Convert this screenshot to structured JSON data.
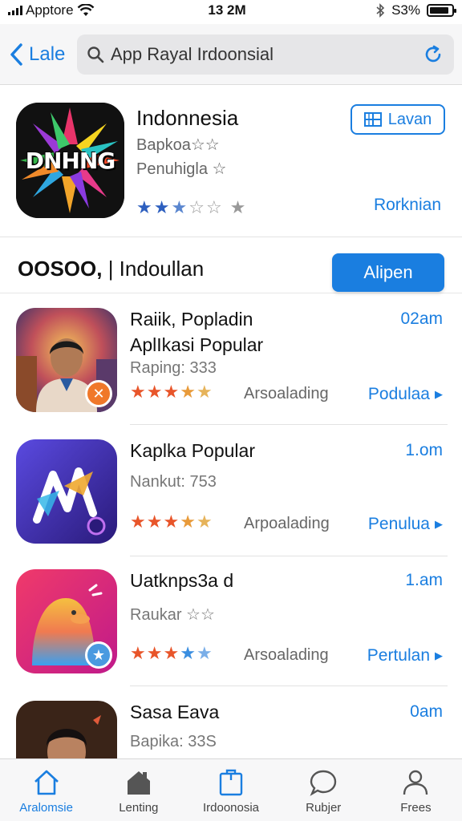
{
  "status_bar": {
    "carrier": "Apptore",
    "time": "13 2M",
    "battery": "S3%",
    "battery_level": 0.9
  },
  "nav": {
    "back_label": "Lale",
    "search_value": "App Rayal Irdoonsial"
  },
  "featured": {
    "logo_text": "DNHNG",
    "title": "Indonnesia",
    "subtitle1": "Bapkoa☆☆",
    "subtitle2": "Penuhigla ☆",
    "rating": 2.5,
    "button_label": "Lavan",
    "link_label": "Rorknian"
  },
  "section": {
    "title_bold": "OOSOO,",
    "title_rest": " | Indoullan",
    "button_label": "Alipen"
  },
  "apps": [
    {
      "title": "Raiik, Popladin\nAplIkasi Popular",
      "time": "02am",
      "rating_text": "Raping: 333",
      "category": "Arsoalading",
      "link": "Podulaa",
      "stars": 4.5
    },
    {
      "title": "Kaplka Popular",
      "time": "1.om",
      "rating_text": "Nankut: 753",
      "category": "Arpoalading",
      "link": "Penulua",
      "stars": 4.5
    },
    {
      "title": "Uatknps3a d",
      "time": "1.am",
      "rating_text": "Raukar ☆☆",
      "category": "Arsoalading",
      "link": "Pertulan",
      "stars": 3.5
    },
    {
      "title": "Sasa Eava",
      "time": "0am",
      "rating_text": "Bapika: 33S",
      "category": "",
      "link": "",
      "stars": 0
    }
  ],
  "tabs": [
    {
      "label": "Aralomsie",
      "icon": "home-icon",
      "active": true
    },
    {
      "label": "Lenting",
      "icon": "house-icon",
      "active": false
    },
    {
      "label": "Irdoonosia",
      "icon": "bag-icon",
      "active": false
    },
    {
      "label": "Rubjer",
      "icon": "chat-bubble-icon",
      "active": false
    },
    {
      "label": "Frees",
      "icon": "person-icon",
      "active": false
    }
  ],
  "colors": {
    "accent": "#1a7ee0",
    "star_orange": "#e8552a",
    "star_gold": "#e6b35a",
    "star_blue": "#2d6fcf"
  }
}
